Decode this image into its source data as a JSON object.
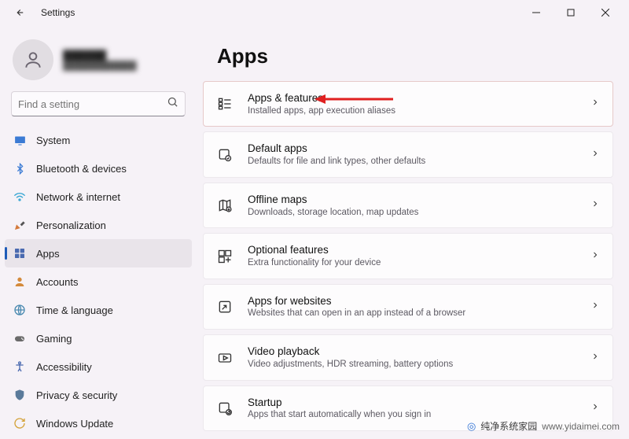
{
  "app_title": "Settings",
  "profile": {
    "name": "██████",
    "email": "████████████"
  },
  "search": {
    "placeholder": "Find a setting"
  },
  "sidebar": {
    "items": [
      {
        "label": "System"
      },
      {
        "label": "Bluetooth & devices"
      },
      {
        "label": "Network & internet"
      },
      {
        "label": "Personalization"
      },
      {
        "label": "Apps"
      },
      {
        "label": "Accounts"
      },
      {
        "label": "Time & language"
      },
      {
        "label": "Gaming"
      },
      {
        "label": "Accessibility"
      },
      {
        "label": "Privacy & security"
      },
      {
        "label": "Windows Update"
      }
    ]
  },
  "page": {
    "title": "Apps"
  },
  "cards": [
    {
      "title": "Apps & features",
      "desc": "Installed apps, app execution aliases"
    },
    {
      "title": "Default apps",
      "desc": "Defaults for file and link types, other defaults"
    },
    {
      "title": "Offline maps",
      "desc": "Downloads, storage location, map updates"
    },
    {
      "title": "Optional features",
      "desc": "Extra functionality for your device"
    },
    {
      "title": "Apps for websites",
      "desc": "Websites that can open in an app instead of a browser"
    },
    {
      "title": "Video playback",
      "desc": "Video adjustments, HDR streaming, battery options"
    },
    {
      "title": "Startup",
      "desc": "Apps that start automatically when you sign in"
    }
  ],
  "watermark": {
    "brand": "纯净系统家园",
    "url": "www.yidaimei.com"
  }
}
